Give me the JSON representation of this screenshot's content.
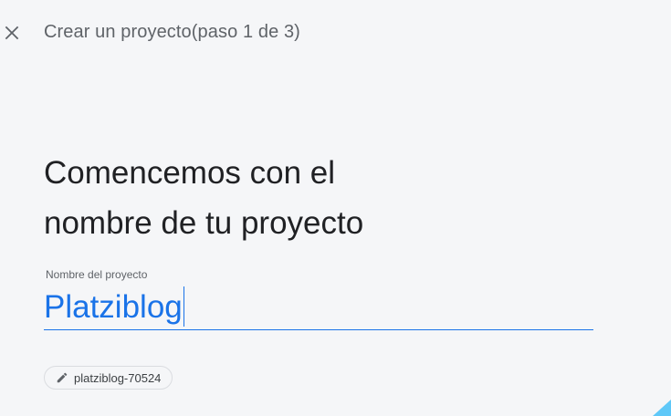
{
  "header": {
    "close_icon": "close-icon",
    "step_title": "Crear un proyecto(paso 1 de 3)"
  },
  "main": {
    "heading_line1": "Comencemos con el",
    "heading_line2": "nombre de tu proyecto",
    "project_name_field": {
      "label": "Nombre del proyecto",
      "value": "Platziblog"
    },
    "project_id_chip": {
      "icon": "pencil-icon",
      "text": "platziblog-70524"
    }
  },
  "colors": {
    "background": "#f5f6f8",
    "accent": "#1a73e8",
    "text_primary": "#202124",
    "text_secondary": "#5f6368"
  }
}
